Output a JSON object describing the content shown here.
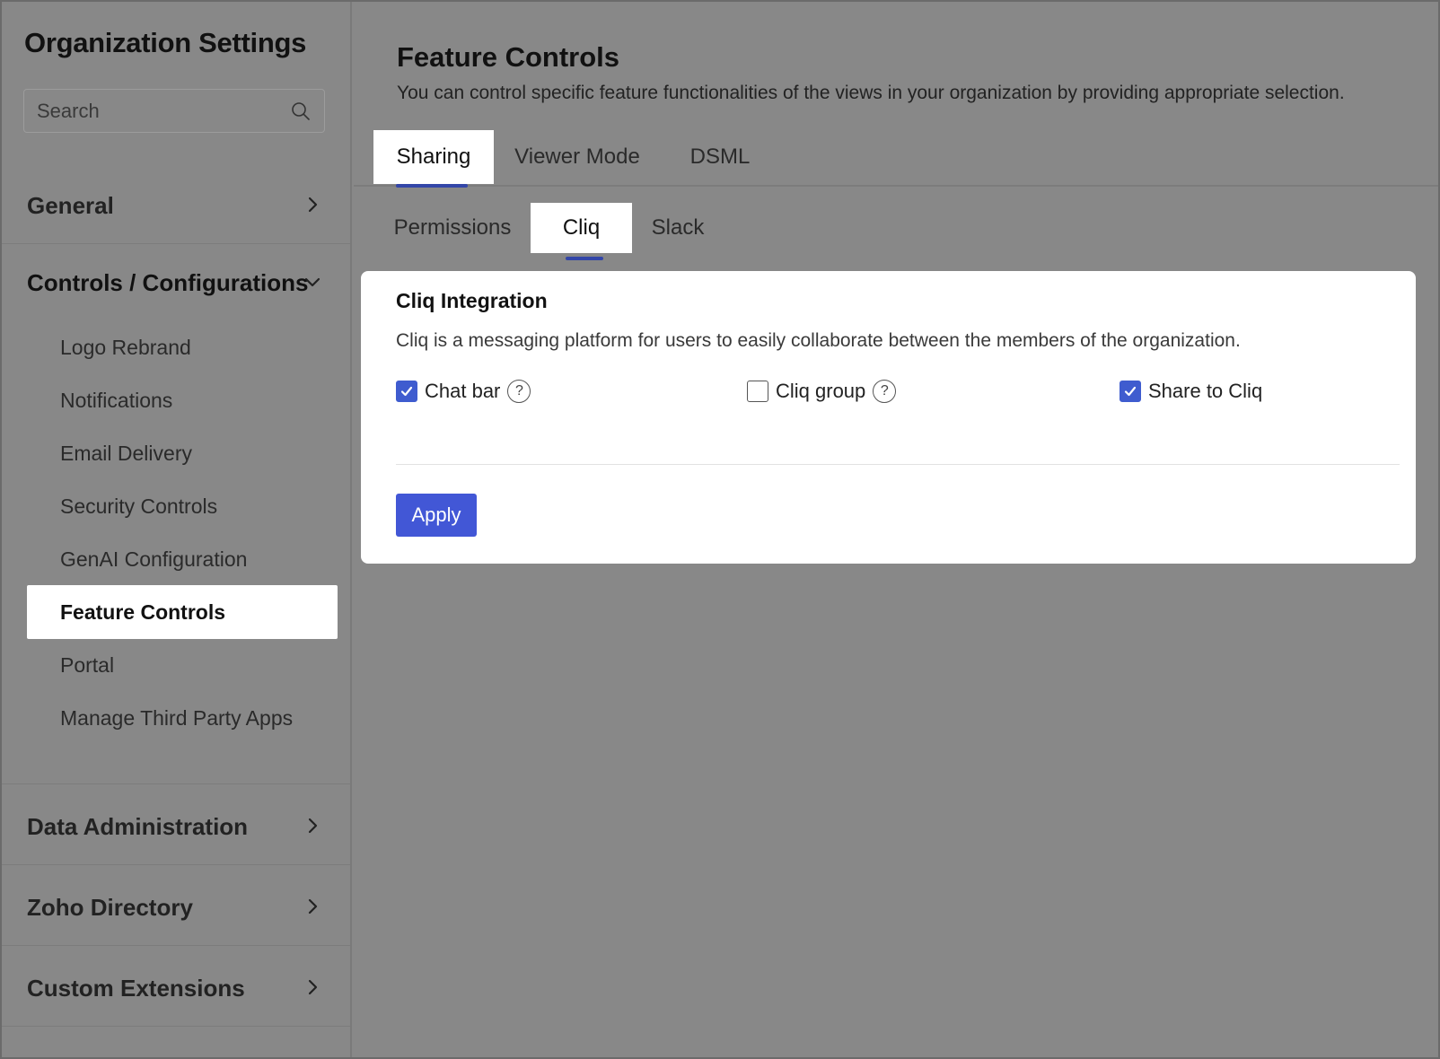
{
  "sidebar": {
    "title": "Organization Settings",
    "search": {
      "placeholder": "Search",
      "value": ""
    },
    "sections": {
      "general": "General",
      "controls": "Controls / Configurations",
      "data_admin": "Data Administration",
      "zoho_directory": "Zoho Directory",
      "custom_extensions": "Custom Extensions"
    },
    "controls_items": [
      "Logo Rebrand",
      "Notifications",
      "Email Delivery",
      "Security Controls",
      "GenAI Configuration",
      "Feature Controls",
      "Portal",
      "Manage Third Party Apps"
    ],
    "active_item": "Feature Controls"
  },
  "main": {
    "title": "Feature Controls",
    "description": "You can control specific feature functionalities of the views in your organization by providing appropriate selection.",
    "tabs": [
      "Sharing",
      "Viewer Mode",
      "DSML"
    ],
    "active_tab": "Sharing",
    "subtabs": [
      "Permissions",
      "Cliq",
      "Slack"
    ],
    "active_subtab": "Cliq",
    "card": {
      "title": "Cliq Integration",
      "description": "Cliq is a messaging platform for users to easily collaborate between the members of the organization.",
      "options": [
        {
          "label": "Chat bar",
          "checked": true,
          "help": true
        },
        {
          "label": "Cliq group",
          "checked": false,
          "help": true
        },
        {
          "label": "Share to Cliq",
          "checked": true,
          "help": false
        }
      ],
      "help_glyph": "?",
      "apply_label": "Apply"
    }
  },
  "colors": {
    "accent": "#4257d6",
    "checkbox_checked": "#3f5ccf",
    "tab_underline": "#3346a8",
    "overlay_bg": "#888888"
  }
}
